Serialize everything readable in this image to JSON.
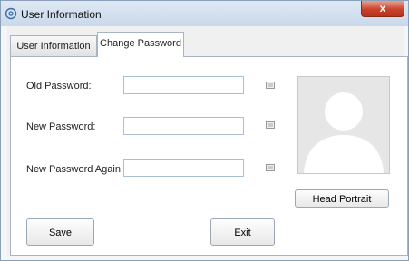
{
  "window": {
    "title": "User Information",
    "close_glyph": "x"
  },
  "tabs": [
    {
      "label": "User Information",
      "active": false
    },
    {
      "label": "Change Password",
      "active": true
    }
  ],
  "form": {
    "old_password_label": "Old Password:",
    "new_password_label": "New Password:",
    "new_password_again_label": "New Password Again:",
    "old_password_value": "",
    "new_password_value": "",
    "new_password_again_value": ""
  },
  "portrait": {
    "button_label": "Head Portrait"
  },
  "actions": {
    "save_label": "Save",
    "exit_label": "Exit"
  },
  "colors": {
    "close_button": "#c8432b",
    "input_border": "#a9bfd4",
    "placeholder_avatar": "#ffffff"
  },
  "icons": {
    "window": "settings-icon",
    "password_field": "keyboard-icon"
  }
}
